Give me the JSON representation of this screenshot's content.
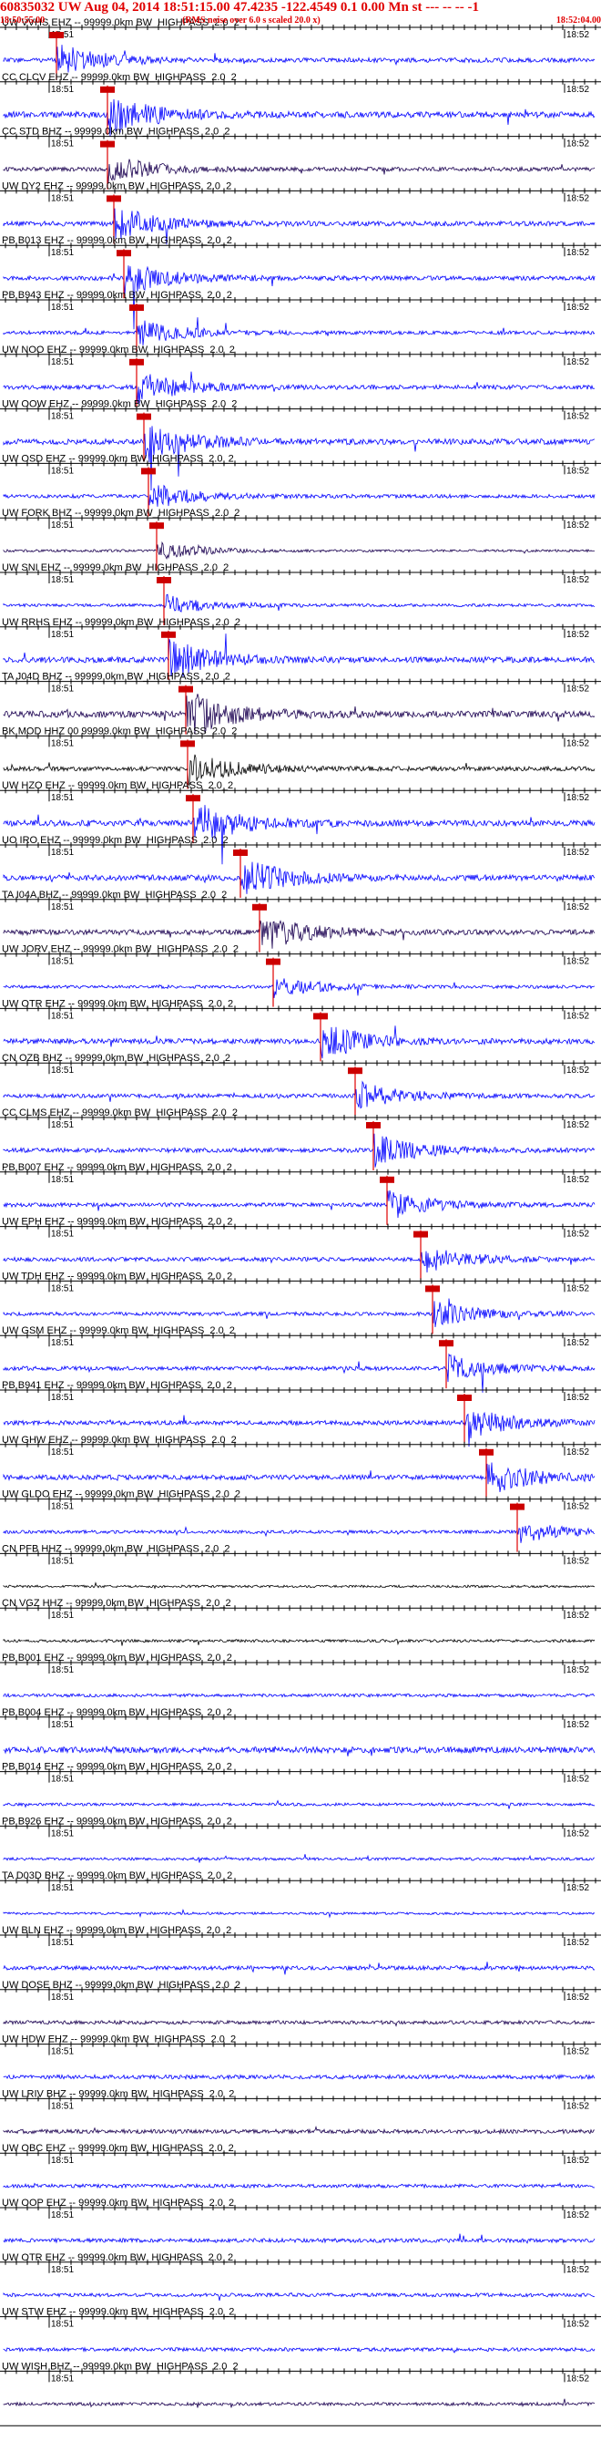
{
  "header": {
    "title": "60835032 UW Aug 04, 2014 18:51:15.00   47.4235 -122.4549  0.1 0.00 Mn st --- -- --  -1",
    "start_time": "18:50:55.00",
    "note": "(RMS noise over 6.0 s scaled 20.0 x)",
    "end_time": "18:52:04.00"
  },
  "time_labels": {
    "left": "18:51",
    "right": "18:52"
  },
  "colors": {
    "header": "#e00000",
    "trace_blue": "#0000ff",
    "trace_dark": "#1a0050",
    "trace_black": "#000000",
    "pick_line": "#e00000",
    "pick_box": "#cc0000"
  },
  "traces": [
    {
      "label": "UW VVHS EHZ -- 99999.0km BW_HIGHPASS_2.0_2",
      "color": "blue",
      "amp": 0.55
    },
    {
      "label": "CC CLCV EHZ -- 99999.0km BW_HIGHPASS_2.0_2",
      "color": "blue",
      "amp": 0.75
    },
    {
      "label": "CC STD BHZ -- 99999.0km BW_HIGHPASS_2.0_2",
      "color": "dark",
      "amp": 0.5
    },
    {
      "label": "UW DY2 EHZ -- 99999.0km BW_HIGHPASS_2.0_2",
      "color": "blue",
      "amp": 0.6
    },
    {
      "label": "PB B013 EHZ -- 99999.0km BW_HIGHPASS_2.0_2",
      "color": "blue",
      "amp": 0.55
    },
    {
      "label": "PB B943 EHZ -- 99999.0km BW_HIGHPASS_2.0_2",
      "color": "blue",
      "amp": 0.45
    },
    {
      "label": "UW NOO EHZ -- 99999.0km BW_HIGHPASS_2.0_2",
      "color": "blue",
      "amp": 0.55
    },
    {
      "label": "UW OOW EHZ -- 99999.0km BW_HIGHPASS_2.0_2",
      "color": "blue",
      "amp": 0.7
    },
    {
      "label": "UW OSD EHZ -- 99999.0km BW_HIGHPASS_2.0_2",
      "color": "blue",
      "amp": 0.45
    },
    {
      "label": "UW FORK BHZ -- 99999.0km BW_HIGHPASS_2.0_2",
      "color": "dark",
      "amp": 0.3
    },
    {
      "label": "UW SNI EHZ -- 99999.0km BW_HIGHPASS_2.0_2",
      "color": "blue",
      "amp": 0.35
    },
    {
      "label": "UW RRHS EHZ -- 99999.0km BW_HIGHPASS_2.0_2",
      "color": "blue",
      "amp": 0.7
    },
    {
      "label": "TA J04D BHZ -- 99999.0km BW_HIGHPASS_2.0_2",
      "color": "dark",
      "amp": 0.8
    },
    {
      "label": "BK MOD HHZ 00 99999.0km BW_HIGHPASS_2.0_2",
      "color": "black",
      "amp": 0.55
    },
    {
      "label": "UW HZO EHZ -- 99999.0km BW_HIGHPASS_2.0_2",
      "color": "blue",
      "amp": 0.75
    },
    {
      "label": "UO IRO EHZ -- 99999.0km BW_HIGHPASS_2.0_2",
      "color": "blue",
      "amp": 0.7
    },
    {
      "label": "TA I04A BHZ -- 99999.0km BW_HIGHPASS_2.0_2",
      "color": "dark",
      "amp": 0.65
    },
    {
      "label": "UW JORV EHZ -- 99999.0km BW_HIGHPASS_2.0_2",
      "color": "blue",
      "amp": 0.4
    },
    {
      "label": "UW OTR EHZ -- 99999.0km BW_HIGHPASS_2.0_2",
      "color": "blue",
      "amp": 0.65
    },
    {
      "label": "CN OZB BHZ -- 99999.0km BW_HIGHPASS_2.0_2",
      "color": "blue",
      "amp": 0.5
    },
    {
      "label": "CC CLMS EHZ -- 99999.0km BW_HIGHPASS_2.0_2",
      "color": "blue",
      "amp": 0.55
    },
    {
      "label": "PB B007 EHZ -- 99999.0km BW_HIGHPASS_2.0_2",
      "color": "blue",
      "amp": 0.5
    },
    {
      "label": "UW EPH EHZ -- 99999.0km BW_HIGHPASS_2.0_2",
      "color": "blue",
      "amp": 0.5
    },
    {
      "label": "UW TDH EHZ -- 99999.0km BW_HIGHPASS_2.0_2",
      "color": "blue",
      "amp": 0.45
    },
    {
      "label": "UW GSM EHZ -- 99999.0km BW_HIGHPASS_2.0_2",
      "color": "blue",
      "amp": 0.5
    },
    {
      "label": "PB B941 EHZ -- 99999.0km BW_HIGHPASS_2.0_2",
      "color": "blue",
      "amp": 0.55
    },
    {
      "label": "UW GHW EHZ -- 99999.0km BW_HIGHPASS_2.0_2",
      "color": "blue",
      "amp": 0.6
    },
    {
      "label": "UW GLDO EHZ -- 99999.0km BW_HIGHPASS_2.0_2",
      "color": "blue",
      "amp": 0.4
    },
    {
      "label": "CN PFB HHZ -- 99999.0km BW_HIGHPASS_2.0_2",
      "color": "black",
      "amp": 0.3
    },
    {
      "label": "CN VGZ HHZ -- 99999.0km BW_HIGHPASS_2.0_2",
      "color": "black",
      "amp": 0.35
    },
    {
      "label": "PB B001 EHZ -- 99999.0km BW_HIGHPASS_2.0_2",
      "color": "blue",
      "amp": 0.4
    },
    {
      "label": "PB B004 EHZ -- 99999.0km BW_HIGHPASS_2.0_2",
      "color": "blue",
      "amp": 0.75
    },
    {
      "label": "PB B014 EHZ -- 99999.0km BW_HIGHPASS_2.0_2",
      "color": "blue",
      "amp": 0.35
    },
    {
      "label": "PB B926 EHZ -- 99999.0km BW_HIGHPASS_2.0_2",
      "color": "blue",
      "amp": 0.35
    },
    {
      "label": "TA D03D BHZ -- 99999.0km BW_HIGHPASS_2.0_2",
      "color": "blue",
      "amp": 0.3
    },
    {
      "label": "UW BLN EHZ -- 99999.0km BW_HIGHPASS_2.0_2",
      "color": "blue",
      "amp": 0.5
    },
    {
      "label": "UW DOSE BHZ -- 99999.0km BW_HIGHPASS_2.0_2",
      "color": "dark",
      "amp": 0.45
    },
    {
      "label": "UW HDW EHZ -- 99999.0km BW_HIGHPASS_2.0_2",
      "color": "blue",
      "amp": 0.5
    },
    {
      "label": "UW LRIV BHZ -- 99999.0km BW_HIGHPASS_2.0_2",
      "color": "dark",
      "amp": 0.5
    },
    {
      "label": "UW OBC EHZ -- 99999.0km BW_HIGHPASS_2.0_2",
      "color": "blue",
      "amp": 0.45
    },
    {
      "label": "UW OOP EHZ -- 99999.0km BW_HIGHPASS_2.0_2",
      "color": "blue",
      "amp": 0.5
    },
    {
      "label": "UW OTR EHZ -- 99999.0km BW_HIGHPASS_2.0_2",
      "color": "blue",
      "amp": 0.45
    },
    {
      "label": "UW STW EHZ -- 99999.0km BW_HIGHPASS_2.0_2",
      "color": "blue",
      "amp": 0.45
    },
    {
      "label": "UW WISH BHZ -- 99999.0km BW_HIGHPASS_2.0_2",
      "color": "dark",
      "amp": 0.4
    }
  ]
}
